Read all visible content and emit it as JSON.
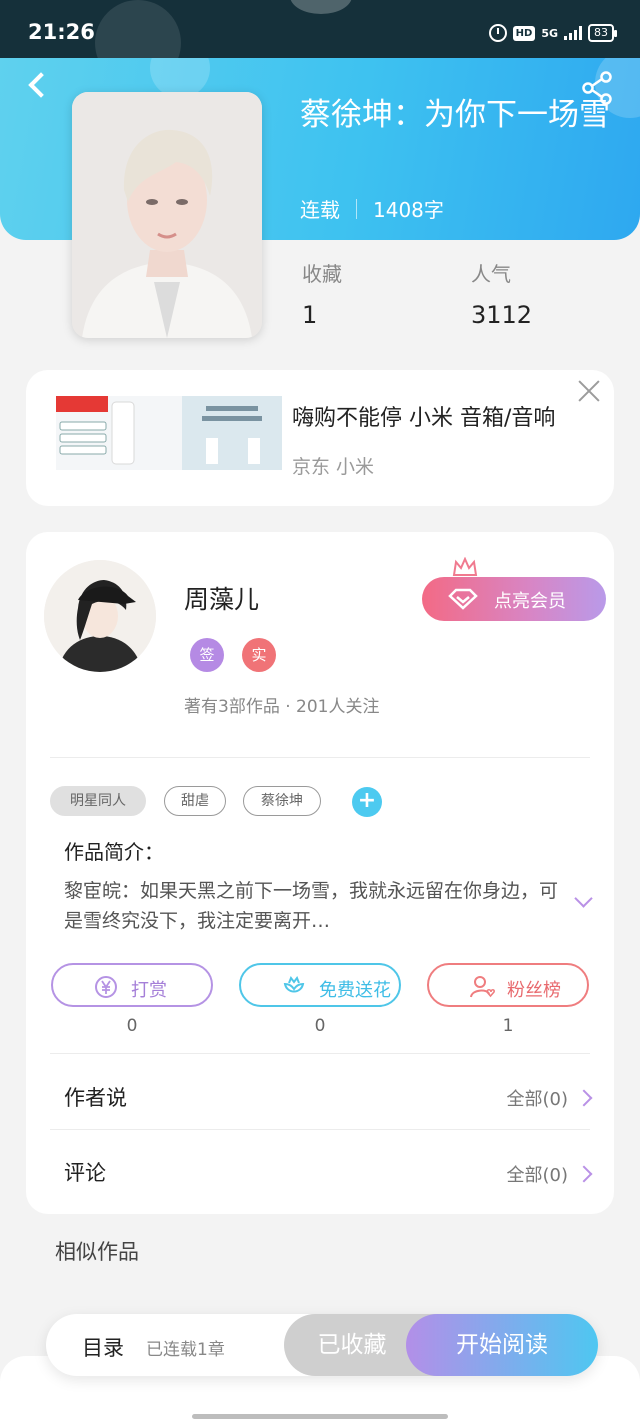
{
  "status_bar": {
    "time": "21:26",
    "network": "5G",
    "hd": "HD",
    "battery": "83"
  },
  "book": {
    "title": "蔡徐坤：为你下一场雪",
    "status": "连载",
    "word_count": "1408字",
    "stats": [
      {
        "label": "收藏",
        "value": "1"
      },
      {
        "label": "人气",
        "value": "3112"
      }
    ]
  },
  "ad": {
    "title": "嗨购不能停  小米  音箱/音响",
    "subtitle": "京东  小米"
  },
  "author": {
    "name": "周藻儿",
    "badges": [
      "签",
      "实"
    ],
    "stats_text": "著有3部作品 · 201人关注",
    "vip_button": "点亮会员"
  },
  "tags": [
    "明星同人",
    "甜虐",
    "蔡徐坤"
  ],
  "intro": {
    "label": "作品简介：",
    "text": "黎宦皖：如果天黑之前下一场雪，我就永远留在你身边，可是雪终究没下，我注定要离开…"
  },
  "actions": [
    {
      "label": "打赏",
      "count": "0"
    },
    {
      "label": "免费送花",
      "count": "0"
    },
    {
      "label": "粉丝榜",
      "count": "1"
    }
  ],
  "sections": [
    {
      "label": "作者说",
      "right": "全部(0)"
    },
    {
      "label": "评论",
      "right": "全部(0)"
    }
  ],
  "similar_title": "相似作品",
  "bottom": {
    "toc_label": "目录",
    "toc_sub": "已连载1章",
    "fav_label": "已收藏",
    "read_label": "开始阅读"
  },
  "colors": {
    "header_gradient_start": "#5fd1ee",
    "header_gradient_end": "#2ea8f0",
    "accent_purple": "#b593e4",
    "accent_cyan": "#4fc6e8",
    "accent_red": "#ef7d7f",
    "vip_gradient_start": "#f36a85",
    "vip_gradient_end": "#b99ae9"
  }
}
